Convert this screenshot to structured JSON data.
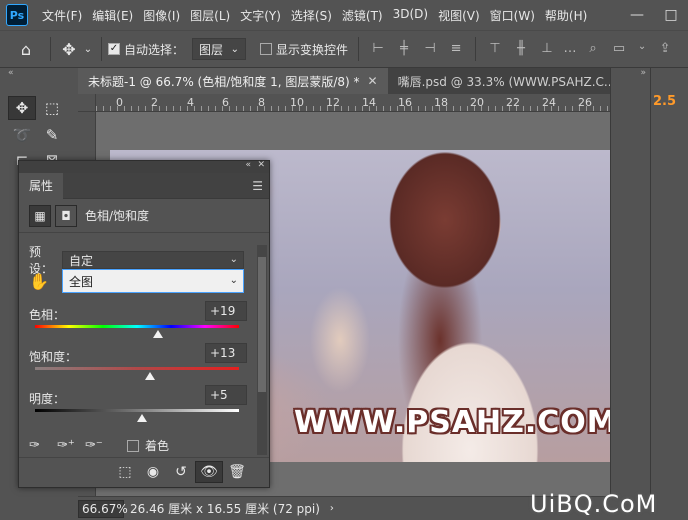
{
  "app": {
    "logo": "Ps"
  },
  "menu": [
    "文件(F)",
    "编辑(E)",
    "图像(I)",
    "图层(L)",
    "文字(Y)",
    "选择(S)",
    "滤镜(T)",
    "3D(D)",
    "视图(V)",
    "窗口(W)",
    "帮助(H)"
  ],
  "window_controls": {
    "minimize": "—",
    "restore": "□",
    "close": "✕"
  },
  "options": {
    "auto_select_label": "自动选择：",
    "auto_select_checked": true,
    "layer_select": "图层",
    "show_transform_label": "显示变换控件",
    "show_transform_checked": false
  },
  "tabs": [
    {
      "label": "未标题-1 @ 66.7% (色相/饱和度 1, 图层蒙版/8) *",
      "active": true
    },
    {
      "label": "嘴唇.psd @ 33.3% (WWW.PSAHZ.C...",
      "active": false
    }
  ],
  "ruler": [
    "0",
    "2",
    "4",
    "6",
    "8",
    "10",
    "12",
    "14",
    "16",
    "18",
    "20",
    "22",
    "24",
    "26"
  ],
  "right_panel": {
    "value": "2.5"
  },
  "properties": {
    "title": "属性",
    "adjustment_name": "色相/饱和度",
    "preset_label": "预设：",
    "preset_value": "自定",
    "channel_value": "全图",
    "hue_label": "色相：",
    "hue_value": "+19",
    "hue_level": 0.605,
    "saturation_label": "饱和度：",
    "saturation_value": "+13",
    "saturation_level": 0.565,
    "lightness_label": "明度：",
    "lightness_value": "+5",
    "lightness_level": 0.525,
    "colorize_label": "着色",
    "colorize_checked": false
  },
  "canvas": {
    "watermark": "WWW.PSAHZ.COM"
  },
  "status": {
    "zoom": "66.67%",
    "doc_info": "26.46 厘米 x 16.55 厘米 (72 ppi)"
  },
  "site_logo": "UiBQ.CoM",
  "colors": {
    "accent_orange": "#ff9a2a",
    "panel_bg": "#535353",
    "watermark_outline": "#6a2e2a"
  }
}
